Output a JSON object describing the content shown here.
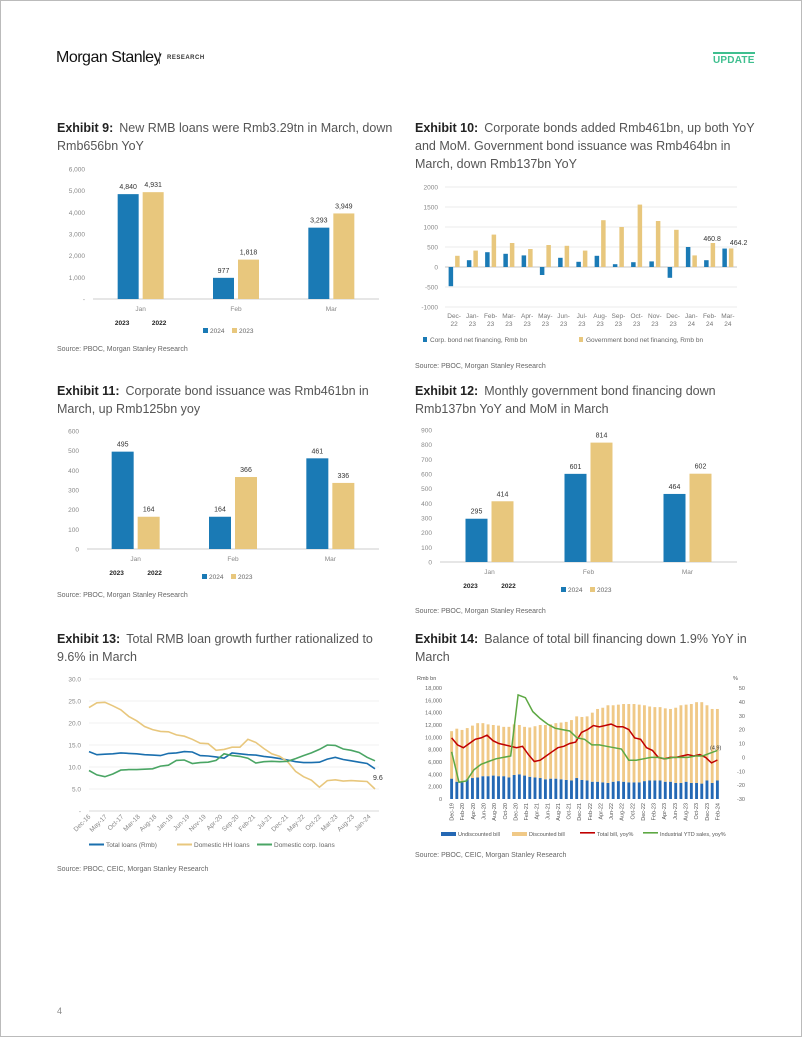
{
  "header": {
    "brand": "Morgan Stanley",
    "section": "RESEARCH",
    "badge": "UPDATE"
  },
  "colors": {
    "blue": "#1a7ab5",
    "gold": "#e8c77d",
    "red": "#c00000",
    "green": "#5da843",
    "hh": "#e8c77d",
    "corp": "#4aa564",
    "total": "#1a6fae",
    "update": "#3fbf8f"
  },
  "page_number": "4",
  "chart_data": [
    {
      "id": "ex9",
      "type": "bar",
      "label": "Exhibit 9:",
      "title": "New RMB loans were Rmb3.29tn in March, down Rmb656bn YoY",
      "categories": [
        "Jan",
        "Feb",
        "Mar"
      ],
      "series": [
        {
          "name": "2024",
          "values": [
            4840,
            977,
            3293
          ],
          "labels": [
            "4,840",
            "977",
            "3,293"
          ]
        },
        {
          "name": "2023",
          "values": [
            4931,
            1818,
            3949
          ],
          "labels": [
            "4,931",
            "1,818",
            "3,949"
          ]
        }
      ],
      "year_notes": [
        "2023",
        "2022"
      ],
      "yticks": [
        "-",
        "1,000",
        "2,000",
        "3,000",
        "4,000",
        "5,000",
        "6,000"
      ],
      "ylim": [
        0,
        6000
      ],
      "source": "Source: PBOC, Morgan Stanley Research"
    },
    {
      "id": "ex10",
      "type": "bar",
      "label": "Exhibit 10:",
      "title": "Corporate bonds added Rmb461bn, up both YoY and MoM. Government bond issuance was Rmb464bn in March, down Rmb137bn YoY",
      "categories": [
        "Dec-22",
        "Jan-23",
        "Feb-23",
        "Mar-23",
        "Apr-23",
        "May-23",
        "Jun-23",
        "Jul-23",
        "Aug-23",
        "Sep-23",
        "Oct-23",
        "Nov-23",
        "Dec-23",
        "Jan-24",
        "Feb-24",
        "Mar-24"
      ],
      "series": [
        {
          "name": "Corp. bond net financing, Rmb bn",
          "values": [
            -480,
            170,
            370,
            330,
            290,
            -200,
            230,
            130,
            280,
            70,
            120,
            140,
            -270,
            500,
            170,
            460.8
          ]
        },
        {
          "name": "Government bond net financing, Rmb bn",
          "values": [
            280,
            410,
            810,
            600,
            450,
            550,
            530,
            410,
            1170,
            1000,
            1560,
            1150,
            930,
            290,
            600,
            464.2
          ]
        }
      ],
      "annotations": [
        "460.8",
        "464.2"
      ],
      "yticks": [
        "-1000",
        "-500",
        "0",
        "500",
        "1000",
        "1500",
        "2000"
      ],
      "ylim": [
        -1000,
        2000
      ],
      "source": "Source: PBOC, Morgan Stanley Research"
    },
    {
      "id": "ex11",
      "type": "bar",
      "label": "Exhibit 11:",
      "title": "Corporate bond issuance was Rmb461bn in March, up Rmb125bn yoy",
      "categories": [
        "Jan",
        "Feb",
        "Mar"
      ],
      "series": [
        {
          "name": "2024",
          "values": [
            495,
            164,
            461
          ],
          "labels": [
            "495",
            "164",
            "461"
          ]
        },
        {
          "name": "2023",
          "values": [
            164,
            366,
            336
          ],
          "labels": [
            "164",
            "366",
            "336"
          ]
        }
      ],
      "year_notes": [
        "2023",
        "2022"
      ],
      "yticks": [
        "0",
        "100",
        "200",
        "300",
        "400",
        "500",
        "600"
      ],
      "ylim": [
        0,
        600
      ],
      "source": "Source: PBOC, Morgan Stanley Research"
    },
    {
      "id": "ex12",
      "type": "bar",
      "label": "Exhibit 12:",
      "title": "Monthly government bond financing down Rmb137bn YoY and MoM in March",
      "categories": [
        "Jan",
        "Feb",
        "Mar"
      ],
      "series": [
        {
          "name": "2024",
          "values": [
            295,
            601,
            464
          ],
          "labels": [
            "295",
            "601",
            "464"
          ]
        },
        {
          "name": "2023",
          "values": [
            414,
            814,
            602
          ],
          "labels": [
            "414",
            "814",
            "602"
          ]
        }
      ],
      "year_notes": [
        "2023",
        "2022"
      ],
      "yticks": [
        "0",
        "100",
        "200",
        "300",
        "400",
        "500",
        "600",
        "700",
        "800",
        "900"
      ],
      "ylim": [
        0,
        900
      ],
      "source": "Source: PBOC, Morgan Stanley Research"
    },
    {
      "id": "ex13",
      "type": "line",
      "label": "Exhibit 13:",
      "title": "Total RMB loan growth further rationalized to 9.6% in March",
      "xticks": [
        "Dec-16",
        "May-17",
        "Oct-17",
        "Mar-18",
        "Aug-18",
        "Jan-19",
        "Jun-19",
        "Nov-19",
        "Apr-20",
        "Sep-20",
        "Feb-21",
        "Jul-21",
        "Dec-21",
        "May-22",
        "Oct-22",
        "Mar-23",
        "Aug-23",
        "Jan-24"
      ],
      "yticks": [
        "-",
        "5.0",
        "10.0",
        "15.0",
        "20.0",
        "25.0",
        "30.0"
      ],
      "ylim": [
        0,
        30
      ],
      "series": [
        {
          "name": "Total loans (Rmb)",
          "values": [
            13.5,
            12.8,
            12.9,
            13.0,
            13.2,
            13.1,
            13.0,
            12.8,
            12.7,
            12.6,
            13.1,
            13.2,
            13.5,
            13.4,
            12.6,
            12.5,
            12.3,
            12.0,
            13.2,
            13.0,
            12.8,
            12.7,
            12.4,
            12.2,
            11.9,
            11.6,
            11.2,
            11.0,
            11.0,
            11.1,
            11.8,
            12.2,
            11.7,
            11.4,
            11.1,
            10.8,
            9.6
          ]
        },
        {
          "name": "Domestic HH loans",
          "values": [
            23.5,
            24.6,
            24.7,
            23.9,
            23.0,
            21.5,
            20.5,
            19.2,
            18.5,
            18.1,
            18.0,
            17.3,
            17.0,
            16.3,
            15.4,
            15.3,
            13.8,
            14.0,
            14.5,
            14.5,
            16.3,
            15.6,
            14.2,
            13.0,
            12.4,
            11.2,
            9.0,
            7.8,
            7.0,
            5.4,
            6.9,
            7.1,
            6.8,
            6.9,
            6.8,
            6.7,
            5.0
          ]
        },
        {
          "name": "Domestic corp. loans",
          "values": [
            9.2,
            8.2,
            7.8,
            8.4,
            9.3,
            9.4,
            9.4,
            9.5,
            9.6,
            10.2,
            10.4,
            11.5,
            11.6,
            10.8,
            11.0,
            11.1,
            11.5,
            13.0,
            12.6,
            12.4,
            12.0,
            10.9,
            11.2,
            11.3,
            11.2,
            11.3,
            11.9,
            12.6,
            13.2,
            14.0,
            15.0,
            14.9,
            14.1,
            13.8,
            13.3,
            12.2,
            11.4
          ]
        }
      ],
      "end_label": "9.6",
      "source": "Source: PBOC, CEIC, Morgan Stanley Research"
    },
    {
      "id": "ex14",
      "type": "bar",
      "label": "Exhibit 14:",
      "title": "Balance of total bill financing down 1.9% YoY in March",
      "left_axis_label": "Rmb bn",
      "right_axis_label": "%",
      "yticks_left": [
        "0",
        "2,000",
        "4,000",
        "6,000",
        "8,000",
        "10,000",
        "12,000",
        "14,000",
        "16,000",
        "18,000"
      ],
      "yticks_right": [
        "-30",
        "-20",
        "-10",
        "0",
        "10",
        "20",
        "30",
        "40",
        "50"
      ],
      "ylim_left": [
        0,
        18000
      ],
      "ylim_right": [
        -30,
        50
      ],
      "xticks": [
        "Dec-19",
        "Feb-20",
        "Apr-20",
        "Jun-20",
        "Aug-20",
        "Oct-20",
        "Dec-20",
        "Feb-21",
        "Apr-21",
        "Jun-21",
        "Aug-21",
        "Oct-21",
        "Dec-21",
        "Feb-22",
        "Apr-22",
        "Jun-22",
        "Aug-22",
        "Oct-22",
        "Dec-22",
        "Feb-23",
        "Apr-23",
        "Jun-23",
        "Aug-23",
        "Oct-23",
        "Dec-23",
        "Feb-24"
      ],
      "series": [
        {
          "name": "Undiscounted bill",
          "kind": "bar",
          "values": [
            3300,
            2800,
            2700,
            3200,
            3400,
            3500,
            3700,
            3700,
            3800,
            3700,
            3700,
            3500,
            3900,
            4000,
            3800,
            3600,
            3500,
            3400,
            3200,
            3300,
            3300,
            3200,
            3100,
            3000,
            3400,
            3100,
            3000,
            2800,
            2800,
            2700,
            2600,
            2800,
            2900,
            2800,
            2700,
            2700,
            2700,
            2900,
            3000,
            3000,
            3000,
            2800,
            2800,
            2600,
            2600,
            2800,
            2600,
            2600,
            2500,
            3000,
            2600,
            3000
          ]
        },
        {
          "name": "Discounted bill",
          "kind": "bar",
          "values": [
            7700,
            8600,
            8500,
            8300,
            8500,
            8800,
            8600,
            8400,
            8200,
            8200,
            8000,
            8200,
            8200,
            8000,
            7900,
            8000,
            8300,
            8600,
            8800,
            8800,
            9000,
            9200,
            9400,
            9800,
            10000,
            10200,
            10400,
            11200,
            11800,
            12100,
            12600,
            12400,
            12400,
            12600,
            12700,
            12700,
            12600,
            12300,
            12000,
            11900,
            11900,
            11900,
            11800,
            12200,
            12600,
            12500,
            12800,
            13100,
            13200,
            12200,
            12000,
            11600
          ]
        },
        {
          "name": "Total bill, yoy%",
          "kind": "line",
          "values": [
            14,
            9,
            7,
            10,
            13,
            14,
            16,
            12,
            10,
            9,
            8,
            7,
            8,
            2,
            -3,
            -2,
            1,
            4,
            7,
            8,
            10,
            11,
            18,
            20,
            23,
            22,
            23,
            24,
            22,
            22,
            20,
            14,
            13,
            7,
            5,
            0,
            -1,
            0,
            0,
            1,
            2,
            1,
            2,
            0,
            -4,
            -1.9
          ]
        },
        {
          "name": "Industrial YTD sales, yoy%",
          "kind": "line",
          "values": [
            4,
            -18,
            -17,
            -9,
            -5,
            -3,
            -1,
            0,
            1,
            45,
            43,
            33,
            28,
            24,
            21,
            20,
            19,
            14,
            13,
            9,
            9,
            8,
            7,
            6,
            -2,
            -2,
            -1,
            0,
            0,
            -1,
            0,
            0,
            0,
            1,
            1,
            3,
            5
          ]
        }
      ],
      "end_label": "(4.9)",
      "source": "Source: PBOC, CEIC, Morgan Stanley Research"
    }
  ]
}
